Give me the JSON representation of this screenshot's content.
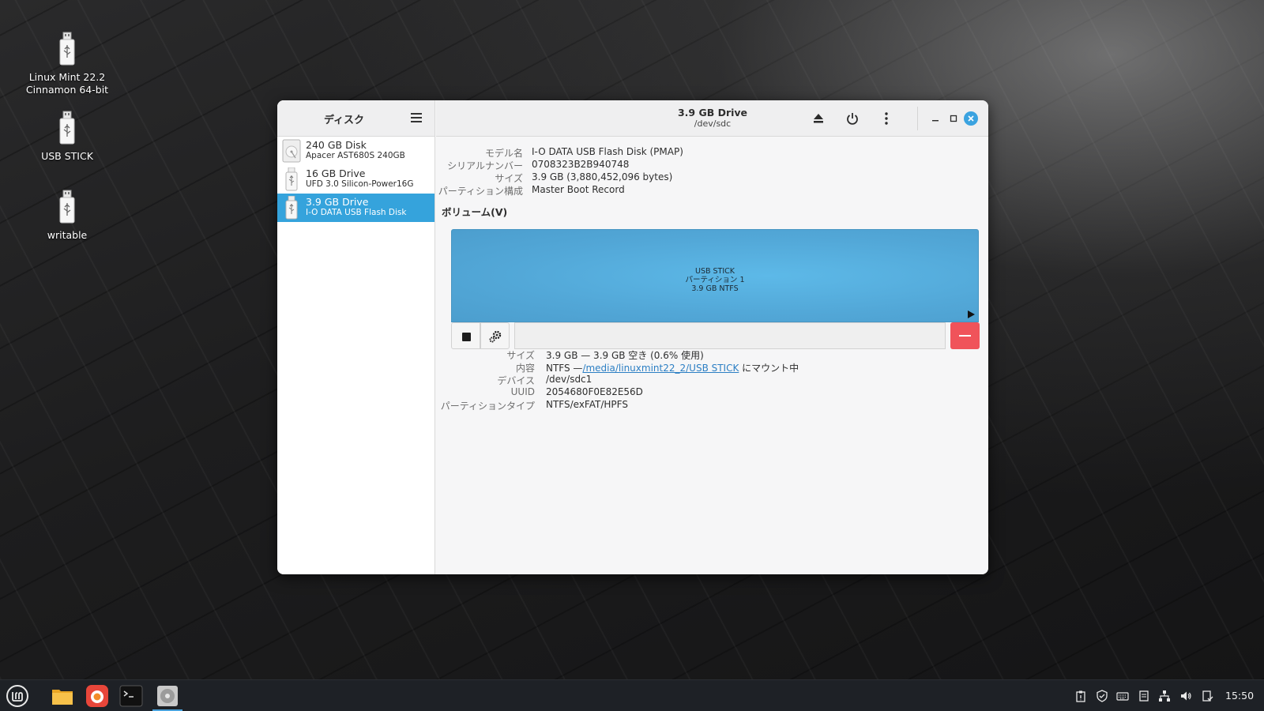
{
  "desktop": {
    "icons": [
      {
        "label_line1": "Linux Mint 22.2",
        "label_line2": "Cinnamon 64-bit"
      },
      {
        "label_line1": "USB STICK",
        "label_line2": ""
      },
      {
        "label_line1": "writable",
        "label_line2": ""
      }
    ]
  },
  "window": {
    "sidebar": {
      "title": "ディスク",
      "disks": [
        {
          "name": "240 GB Disk",
          "sub": "Apacer AST680S 240GB",
          "icon": "hard-disk-icon"
        },
        {
          "name": "16 GB Drive",
          "sub": "UFD 3.0 Silicon-Power16G",
          "icon": "usb-drive-icon"
        },
        {
          "name": "3.9 GB Drive",
          "sub": "I-O DATA USB Flash Disk",
          "icon": "usb-drive-icon"
        }
      ]
    },
    "header": {
      "title": "3.9 GB Drive",
      "subtitle": "/dev/sdc"
    },
    "drive_info": {
      "model_key": "モデル名",
      "model_val": "I-O DATA USB Flash Disk (PMAP)",
      "serial_key": "シリアルナンバー",
      "serial_val": "0708323B2B940748",
      "size_key": "サイズ",
      "size_val": "3.9 GB (3,880,452,096 bytes)",
      "part_key": "パーティション構成",
      "part_val": "Master Boot Record"
    },
    "volumes_label": "ボリューム(V)",
    "partition": {
      "line1": "USB STICK",
      "line2": "パーティション 1",
      "line3": "3.9 GB NTFS"
    },
    "volume_info": {
      "size_key": "サイズ",
      "size_val": "3.9 GB — 3.9 GB 空き (0.6% 使用)",
      "content_key": "内容",
      "content_prefix": "NTFS —",
      "content_link": "/media/linuxmint22_2/USB STICK",
      "content_suffix": "にマウント中",
      "device_key": "デバイス",
      "device_val": "/dev/sdc1",
      "uuid_key": "UUID",
      "uuid_val": "2054680F0E82E56D",
      "ptype_key": "パーティションタイプ",
      "ptype_val": "NTFS/exFAT/HPFS"
    }
  },
  "taskbar": {
    "clock": "15:50"
  },
  "colors": {
    "selection": "#35a3dc",
    "partition": "#52a7d7",
    "delete": "#f0535a",
    "link": "#2c7fc4"
  }
}
